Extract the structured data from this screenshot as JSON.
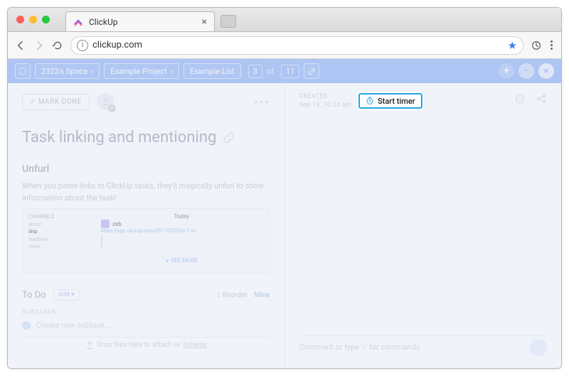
{
  "browser": {
    "tab_title": "ClickUp",
    "url": "clickup.com"
  },
  "topbar": {
    "space": "2323's Space",
    "project": "Example Project",
    "list": "Example List",
    "index": "3",
    "of_word": "of",
    "total": "11"
  },
  "left": {
    "mark_done": "✓ MARK DONE",
    "title": "Task linking and mentioning",
    "unfurl_heading": "Unfurl",
    "unfurl_body": "When you paste links to ClickUp tasks, they'll magically unfurl to show information about the task!",
    "snippet": {
      "channels_label": "CHANNELS",
      "channels": [
        "about",
        "drip",
        "feedback",
        "ideas"
      ],
      "today": "Today",
      "user": "zeb",
      "url": "https://app.clickup.com/2517/2323/v/1.vx",
      "see_more": "∨ SEE MORE"
    },
    "todo": "To Do",
    "add": "Add ▾",
    "reorder": "↕ Reorder",
    "mine": "Mine",
    "subtasks_label": "SUBTASKS",
    "new_subtask": "Create new subtask...",
    "dropzone_pre": "Drop files here to attach or",
    "dropzone_link": "browse"
  },
  "right": {
    "created_label": "CREATED",
    "created_date": "Sep 13, 10:34 am",
    "comment_placeholder": "Comment or type '/' for commands"
  },
  "highlight": {
    "start_timer": "Start timer"
  }
}
